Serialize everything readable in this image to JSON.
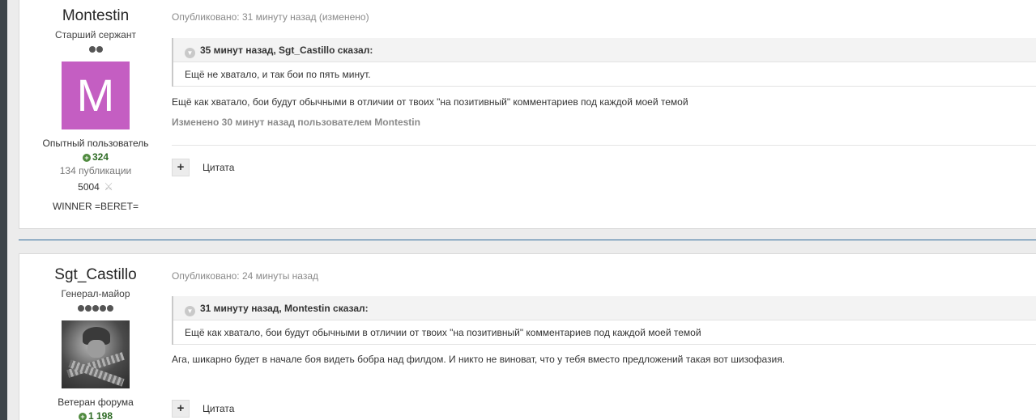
{
  "posts": [
    {
      "author": {
        "name": "Montestin",
        "rank": "Старший сержант",
        "pips": 2,
        "avatar_letter": "M",
        "avatar_color": "#c45ec2",
        "group": "Опытный пользователь",
        "reputation": "324",
        "publications": "134 публикации",
        "battles": "5004",
        "clan": "WINNER =BERET="
      },
      "published": "Опубликовано: 31 минуту назад (изменено)",
      "quote": {
        "header": "35 минут назад, Sgt_Castillo сказал:",
        "text": "Ещё не хватало, и так бои по пять минут."
      },
      "body": "Ещё как хватало, бои будут обычными в отличии от твоих \"на позитивный\" комментариев под каждой моей темой",
      "edited": "Изменено 30 минут назад пользователем Montestin",
      "quote_button": "Цитата"
    },
    {
      "author": {
        "name": "Sgt_Castillo",
        "rank": "Генерал-майор",
        "pips": 5,
        "group": "Ветеран форума",
        "reputation": "1 198"
      },
      "published": "Опубликовано: 24 минуты назад",
      "quote": {
        "header": "31 минуту назад, Montestin сказал:",
        "text": "Ещё как хватало, бои будут обычными в отличии от твоих \"на позитивный\" комментариев под каждой моей темой"
      },
      "body": "Ага, шикарно будет в начале боя видеть бобра над филдом. И никто не виноват, что у тебя вместо предложений такая вот шизофазия.",
      "quote_button": "Цитата"
    }
  ],
  "colors": {
    "separator": "#2f6b9a",
    "reputation": "#2e6b25"
  },
  "icons": {
    "multiquote": "plus-icon",
    "quote_toggle": "chevron-down-icon",
    "reputation": "plus-circle-icon",
    "battles": "crossed-swords-icon"
  }
}
